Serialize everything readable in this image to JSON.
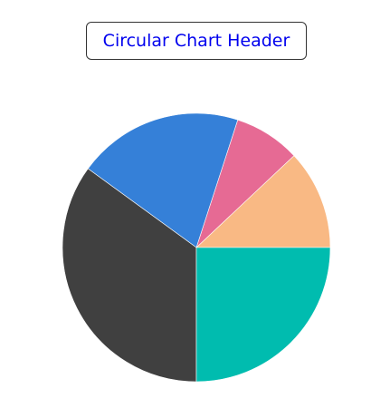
{
  "chart_data": {
    "type": "pie",
    "title": "Circular Chart Header",
    "title_color": "#0000ee",
    "start": "right",
    "direction": "counterclockwise",
    "legend": "none",
    "slices": [
      {
        "value": 12,
        "color": "#f9b984"
      },
      {
        "value": 8,
        "color": "#e66a94"
      },
      {
        "value": 20,
        "color": "#3580d8"
      },
      {
        "value": 35,
        "color": "#404040"
      },
      {
        "value": 25,
        "color": "#00bcaf"
      }
    ]
  }
}
